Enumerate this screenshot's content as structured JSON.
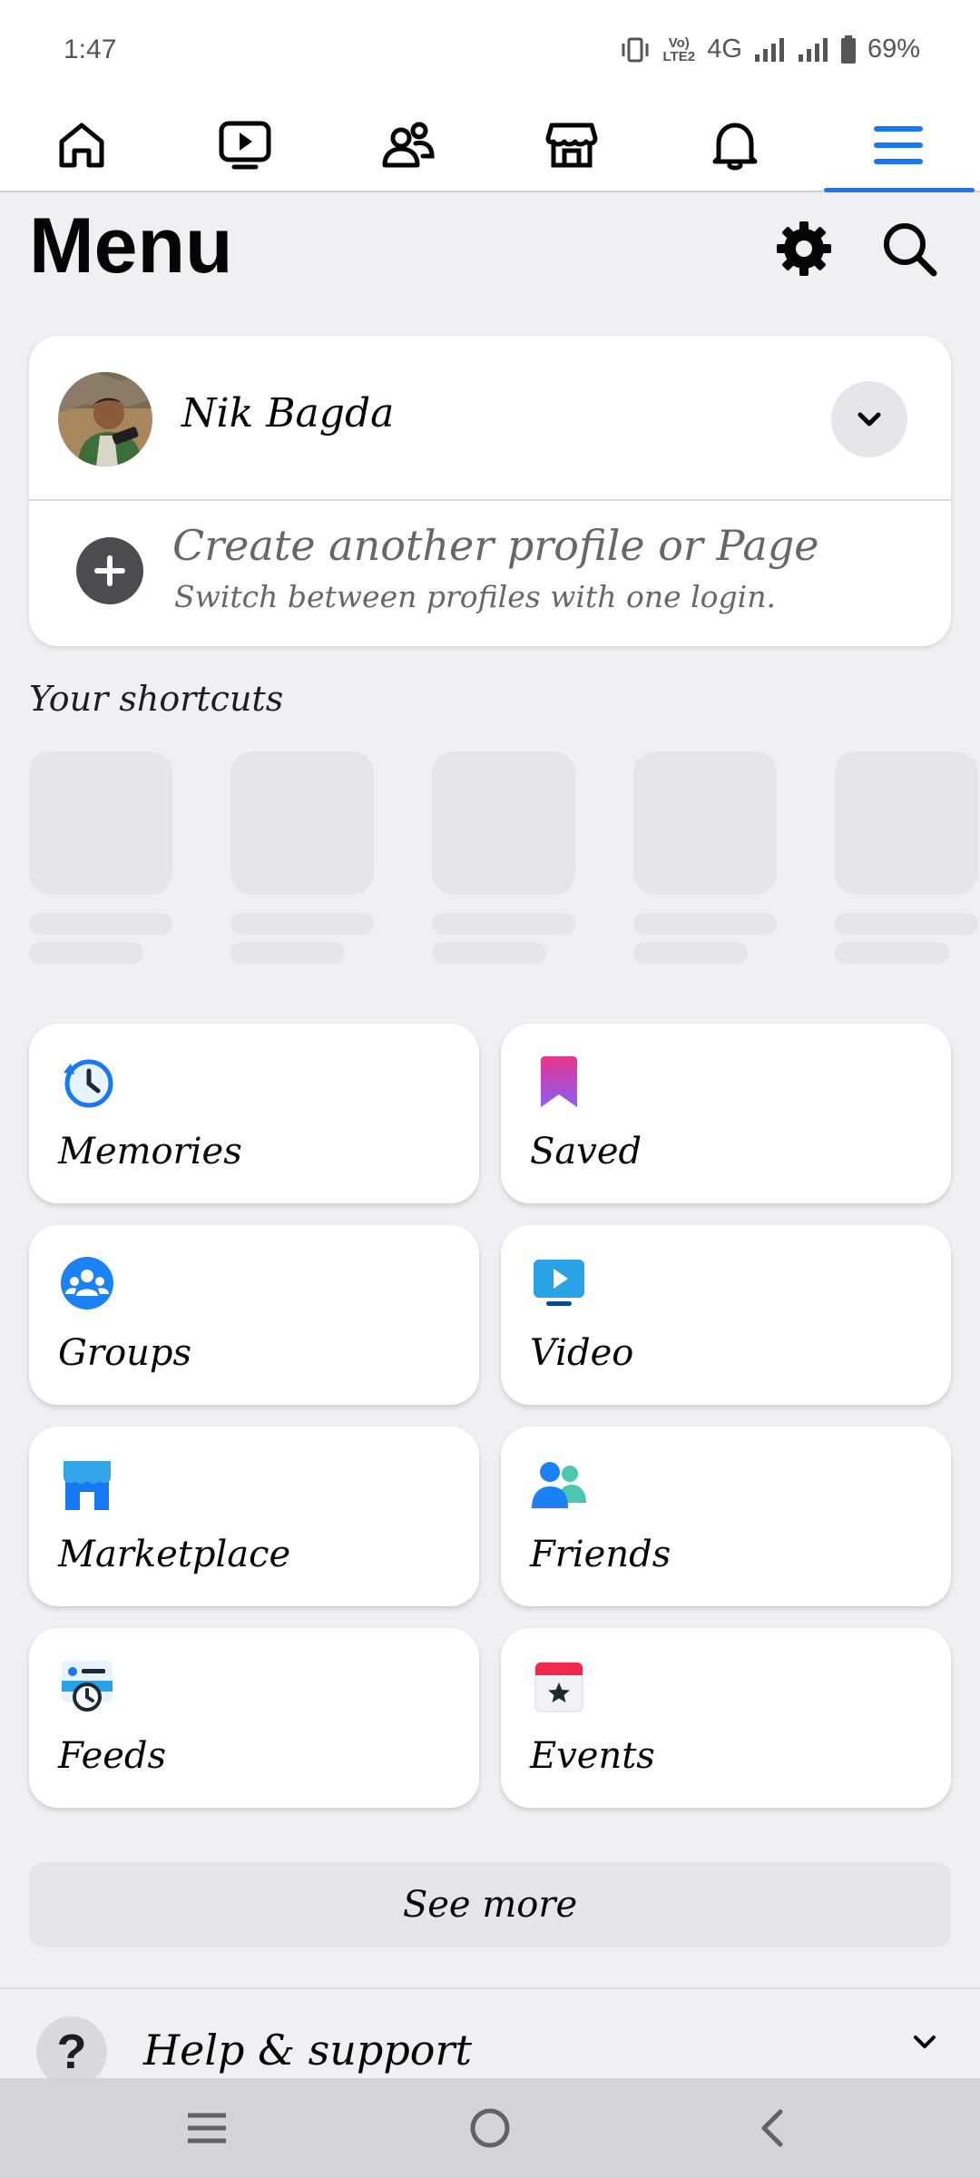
{
  "status_bar": {
    "time": "1:47",
    "network": "4G",
    "volte": "Vo) LTE2",
    "battery": "69%",
    "battery_level": 0.69
  },
  "top_nav": {
    "tabs": [
      "home-icon",
      "video-icon",
      "friends-icon",
      "marketplace-icon",
      "notifications-icon",
      "menu-icon"
    ],
    "active": "menu-icon",
    "accent": "#1877f2"
  },
  "header": {
    "title": "Menu"
  },
  "profile": {
    "name": "Nik Bagda",
    "create_title": "Create another profile or Page",
    "create_subtitle": "Switch between profiles with one login."
  },
  "shortcuts": {
    "title": "Your shortcuts"
  },
  "tiles": [
    {
      "label": "Memories",
      "icon": "memories-icon"
    },
    {
      "label": "Saved",
      "icon": "saved-icon"
    },
    {
      "label": "Groups",
      "icon": "groups-icon"
    },
    {
      "label": "Video",
      "icon": "video-icon"
    },
    {
      "label": "Marketplace",
      "icon": "marketplace-icon"
    },
    {
      "label": "Friends",
      "icon": "friends-icon"
    },
    {
      "label": "Feeds",
      "icon": "feeds-icon"
    },
    {
      "label": "Events",
      "icon": "events-icon"
    }
  ],
  "see_more": "See more",
  "help": {
    "label": "Help & support"
  }
}
